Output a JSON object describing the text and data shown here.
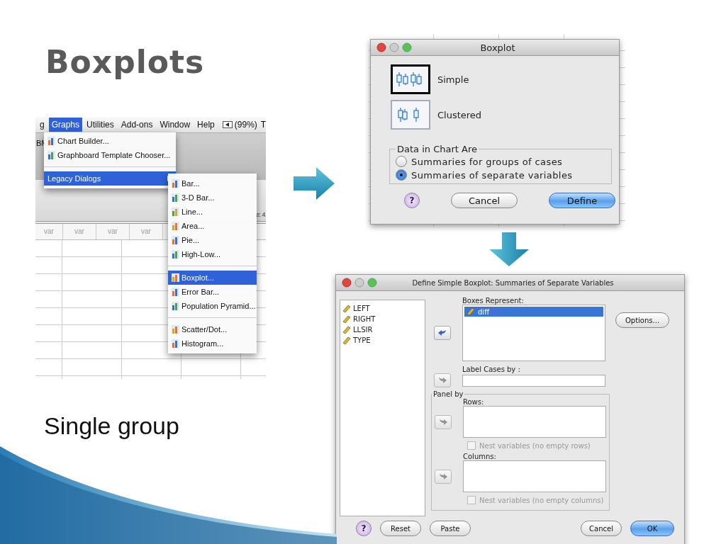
{
  "slide": {
    "title": "Boxplots",
    "caption": "Single group"
  },
  "spss_window": {
    "menu_bar": [
      {
        "label": "g",
        "selected": false
      },
      {
        "label": "Graphs",
        "selected": true
      },
      {
        "label": "Utilities",
        "selected": false
      },
      {
        "label": "Add-ons",
        "selected": false
      },
      {
        "label": "Window",
        "selected": false
      },
      {
        "label": "Help",
        "selected": false
      }
    ],
    "battery": "(99%)",
    "edge_text": "T",
    "toolbar_fragment": "BM",
    "side_fragment": "e: 4",
    "columns": [
      "var",
      "var",
      "var",
      "var"
    ],
    "menu": [
      {
        "label": "Chart Builder...",
        "kind": "item",
        "selected": false
      },
      {
        "label": "Graphboard Template Chooser...",
        "kind": "item",
        "selected": false
      },
      {
        "kind": "separator"
      },
      {
        "label": "Legacy Dialogs",
        "kind": "submenu",
        "selected": true
      }
    ],
    "submenu": [
      {
        "label": "Bar...",
        "kind": "item",
        "selected": false
      },
      {
        "label": "3-D Bar...",
        "kind": "item",
        "selected": false
      },
      {
        "label": "Line...",
        "kind": "item",
        "selected": false
      },
      {
        "label": "Area...",
        "kind": "item",
        "selected": false
      },
      {
        "label": "Pie...",
        "kind": "item",
        "selected": false
      },
      {
        "label": "High-Low...",
        "kind": "item",
        "selected": false
      },
      {
        "kind": "separator"
      },
      {
        "label": "Boxplot...",
        "kind": "item",
        "selected": true
      },
      {
        "label": "Error Bar...",
        "kind": "item",
        "selected": false
      },
      {
        "label": "Population Pyramid...",
        "kind": "item",
        "selected": false
      },
      {
        "kind": "separator"
      },
      {
        "label": "Scatter/Dot...",
        "kind": "item",
        "selected": false
      },
      {
        "label": "Histogram...",
        "kind": "item",
        "selected": false
      }
    ]
  },
  "boxplot_dialog": {
    "title": "Boxplot",
    "chart_types": [
      {
        "label": "Simple",
        "selected": true
      },
      {
        "label": "Clustered",
        "selected": false
      }
    ],
    "group_label": "Data in Chart Are",
    "options": [
      {
        "label": "Summaries for groups of cases",
        "selected": false
      },
      {
        "label": "Summaries of separate variables",
        "selected": true
      }
    ],
    "buttons": [
      {
        "label": "?",
        "kind": "help"
      },
      {
        "label": "Cancel",
        "kind": "normal"
      },
      {
        "label": "Define",
        "kind": "default"
      }
    ]
  },
  "define_dialog": {
    "title": "Define Simple Boxplot: Summaries of Separate Variables",
    "variables": [
      "LEFT",
      "RIGHT",
      "LLSIR",
      "TYPE"
    ],
    "boxes": {
      "label": "Boxes Represent:",
      "move_enabled": true,
      "items": [
        {
          "label": "diff",
          "selected": true
        }
      ]
    },
    "options_button": "Options...",
    "label_cases": {
      "label": "Label Cases by :",
      "move_enabled": false
    },
    "panel_label": "Panel by",
    "rows": {
      "label": "Rows:",
      "move_enabled": false,
      "nest": {
        "label": "Nest variables (no empty rows)",
        "checked": false,
        "disabled": true
      }
    },
    "columns": {
      "label": "Columns:",
      "move_enabled": false,
      "nest": {
        "label": "Nest variables (no empty columns)",
        "checked": false,
        "disabled": true
      }
    },
    "buttons": [
      {
        "label": "?",
        "kind": "help"
      },
      {
        "label": "Reset",
        "kind": "normal"
      },
      {
        "label": "Paste",
        "kind": "normal"
      },
      {
        "kind": "spacer"
      },
      {
        "label": "Cancel",
        "kind": "normal"
      },
      {
        "label": "OK",
        "kind": "default"
      }
    ]
  }
}
